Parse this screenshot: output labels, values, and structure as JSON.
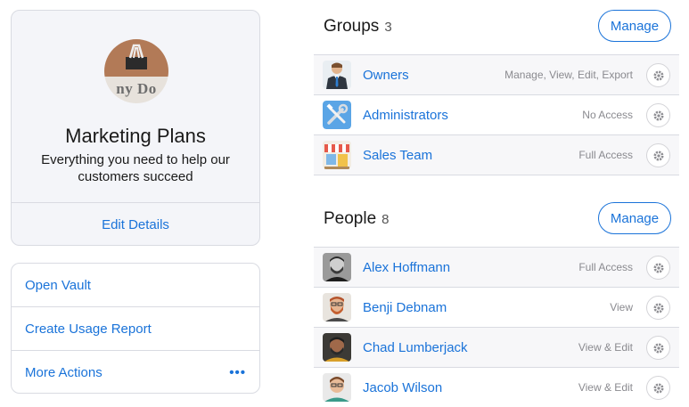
{
  "vault": {
    "avatar_text": "ny Do",
    "title": "Marketing Plans",
    "description": "Everything you need to help our customers succeed",
    "edit_label": "Edit Details"
  },
  "actions": {
    "open_vault": "Open Vault",
    "usage_report": "Create Usage Report",
    "more_actions": "More Actions",
    "more_icon": "•••"
  },
  "groups": {
    "title": "Groups",
    "count": "3",
    "manage_label": "Manage",
    "items": [
      {
        "name": "Owners",
        "permission": "Manage, View, Edit, Export",
        "icon": "owner-icon"
      },
      {
        "name": "Administrators",
        "permission": "No Access",
        "icon": "tools-icon"
      },
      {
        "name": "Sales Team",
        "permission": "Full Access",
        "icon": "storefront-icon"
      }
    ]
  },
  "people": {
    "title": "People",
    "count": "8",
    "manage_label": "Manage",
    "items": [
      {
        "name": "Alex Hoffmann",
        "permission": "Full Access"
      },
      {
        "name": "Benji Debnam",
        "permission": "View"
      },
      {
        "name": "Chad Lumberjack",
        "permission": "View & Edit"
      },
      {
        "name": "Jacob Wilson",
        "permission": "View & Edit"
      }
    ]
  },
  "colors": {
    "accent": "#1a73d9",
    "card_bg": "#f4f5f9",
    "border": "#d9dbe2"
  }
}
